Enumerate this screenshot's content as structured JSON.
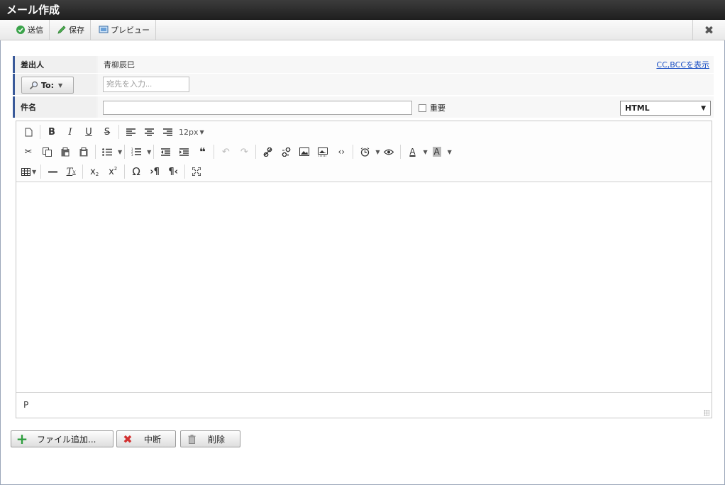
{
  "window": {
    "title": "メール作成"
  },
  "toolbar": {
    "send_label": "送信",
    "save_label": "保存",
    "preview_label": "プレビュー",
    "close_glyph": "✖"
  },
  "form": {
    "sender_label": "差出人",
    "sender_name": "青柳辰巳",
    "cc_bcc_link": "CC,BCCを表示",
    "to_button_label": "To:",
    "to_placeholder": "宛先を入力...",
    "subject_label": "件名",
    "important_label": "重要",
    "format_value": "HTML"
  },
  "editor": {
    "font_size_label": "12px",
    "status_path": "P"
  },
  "footer": {
    "add_file_label": "ファイル追加...",
    "abort_label": "中断",
    "delete_label": "削除"
  },
  "colors": {
    "accent_bar": "#3a5a9a",
    "link": "#1a4fc4",
    "send_icon": "#3aa34a",
    "save_icon": "#4caf50",
    "add_icon": "#2e9e3e",
    "abort_icon": "#d23030"
  }
}
